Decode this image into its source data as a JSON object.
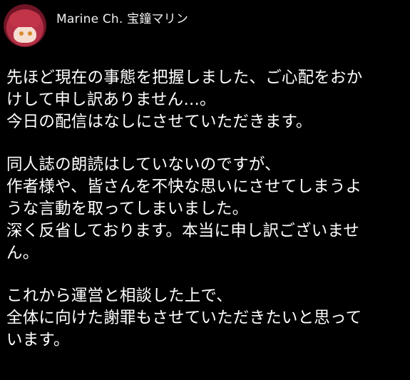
{
  "post": {
    "author_name": "Marine Ch. 宝鐘マリン",
    "avatar_icon": "profile-avatar-icon",
    "paragraphs": [
      {
        "lines": [
          "先ほど現在の事態を把握しました、ご心配をおか",
          "けして申し訳ありません…。",
          "今日の配信はなしにさせていただきます。"
        ]
      },
      {
        "lines": [
          "同人誌の朗読はしていないのですが、",
          "作者様や、皆さんを不快な思いにさせてしまうよ",
          "うな言動を取ってしまいました。",
          "深く反省しております。本当に申し訳ございませ",
          "ん。"
        ]
      },
      {
        "lines": [
          "これから運営と相談した上で、",
          "全体に向けた謝罪もさせていただきたいと思って",
          "います。"
        ]
      }
    ]
  }
}
